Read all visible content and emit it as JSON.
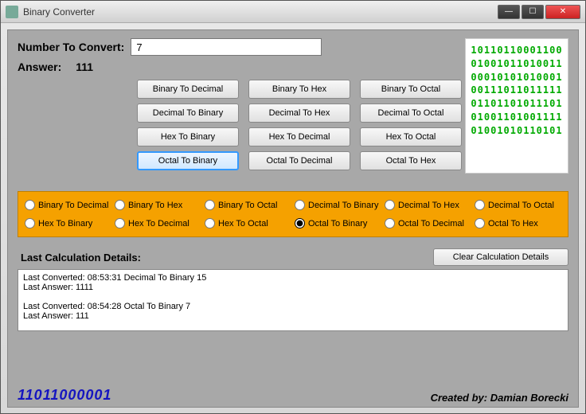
{
  "window": {
    "title": "Binary Converter"
  },
  "input": {
    "label": "Number To Convert:",
    "value": "7"
  },
  "answer": {
    "label": "Answer:",
    "value": "111"
  },
  "buttons": [
    "Binary To Decimal",
    "Binary To Hex",
    "Binary To Octal",
    "Decimal To Binary",
    "Decimal To Hex",
    "Decimal To Octal",
    "Hex To Binary",
    "Hex To Decimal",
    "Hex To Octal",
    "Octal To Binary",
    "Octal To Decimal",
    "Octal To Hex"
  ],
  "selected_button": "Octal To Binary",
  "radios": [
    "Binary To Decimal",
    "Binary To Hex",
    "Binary To Octal",
    "Decimal To Binary",
    "Decimal To Hex",
    "Decimal To Octal",
    "Hex To Binary",
    "Hex To Decimal",
    "Hex To Octal",
    "Octal To Binary",
    "Octal To Decimal",
    "Octal To Hex"
  ],
  "selected_radio": "Octal To Binary",
  "binary_art": [
    "10110110001100",
    "01001011010011",
    "00010101010001",
    "00111011011111",
    "01101101011101",
    "01001101001111",
    "01001010110101"
  ],
  "details": {
    "label": "Last Calculation Details:",
    "clear": "Clear Calculation Details",
    "log": "Last Converted: 08:53:31  Decimal To Binary 15\nLast Answer: 1111\n\nLast Converted: 08:54:28  Octal To Binary 7\nLast Answer: 111"
  },
  "footer": {
    "binary": "11011000001",
    "credit": "Created by: Damian Borecki"
  }
}
